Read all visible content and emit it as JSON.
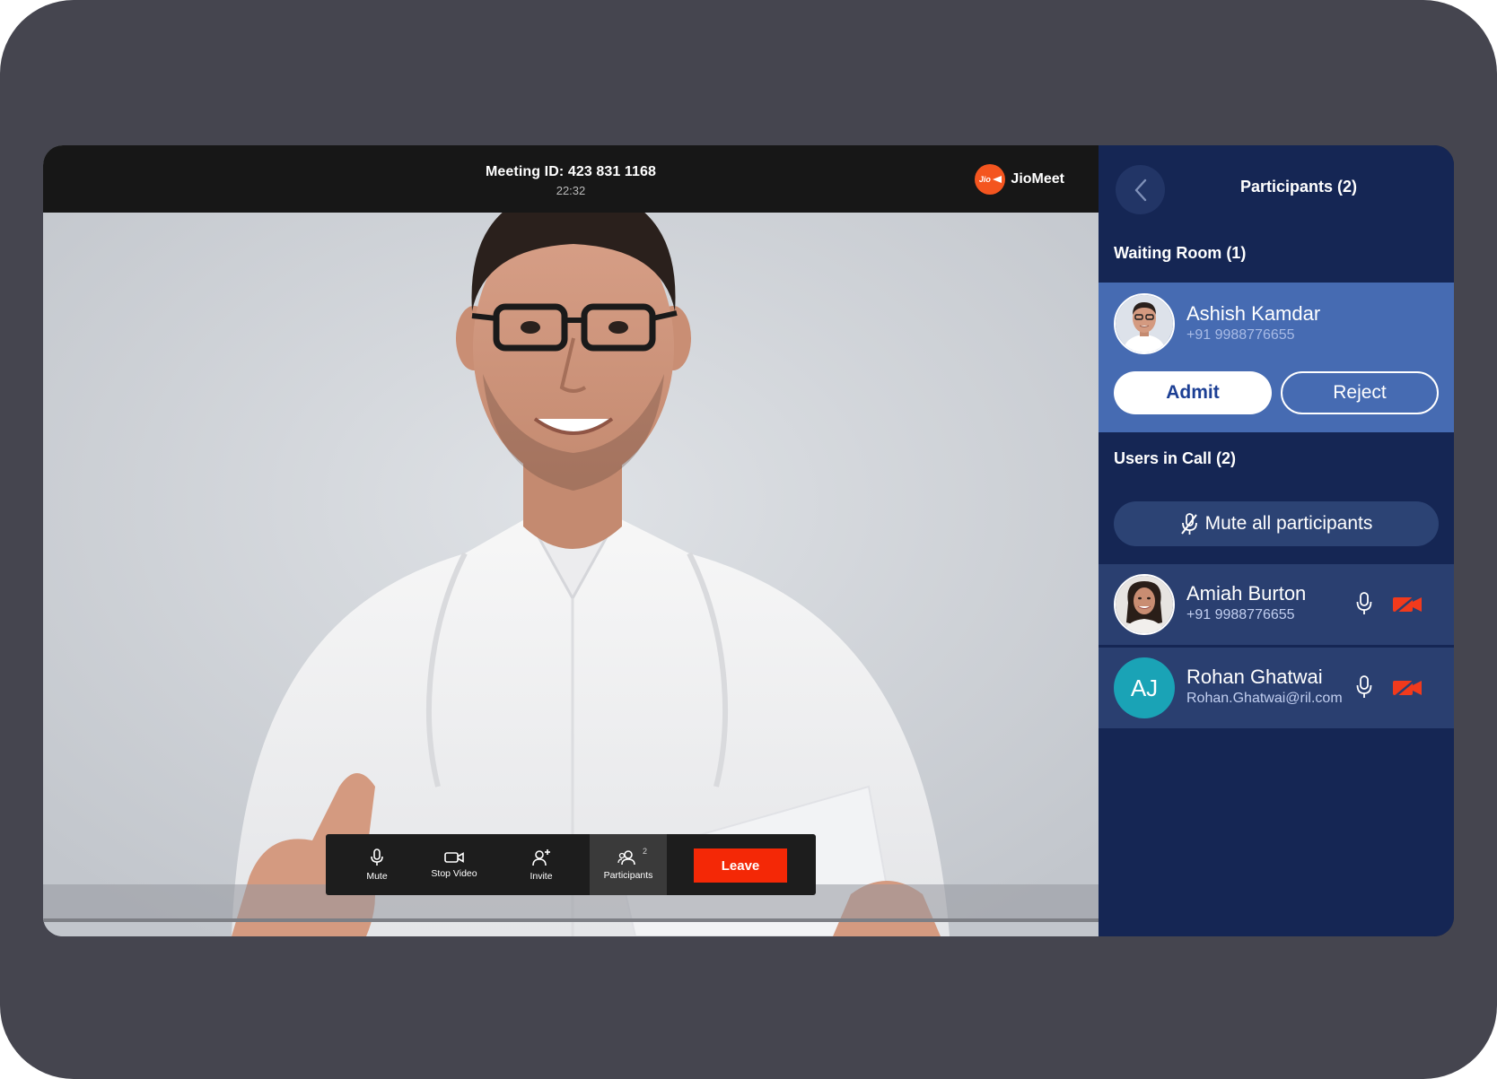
{
  "meeting": {
    "id_label": "Meeting ID: 423 831 1168",
    "time": "22:32",
    "brand_logo_text": "Jio",
    "brand_name": "JioMeet"
  },
  "toolbar": {
    "mute_label": "Mute",
    "stop_video_label": "Stop Video",
    "invite_label": "Invite",
    "participants_label": "Participants",
    "participants_count": "2",
    "leave_label": "Leave"
  },
  "panel": {
    "title": "Participants (2)",
    "waiting_room_title": "Waiting Room (1)",
    "waiting": {
      "name": "Ashish Kamdar",
      "phone": "+91 9988776655",
      "admit_label": "Admit",
      "reject_label": "Reject"
    },
    "users_in_call_title": "Users in Call (2)",
    "mute_all_label": "Mute all participants",
    "users": [
      {
        "name": "Amiah Burton",
        "detail": "+91 9988776655",
        "initials": ""
      },
      {
        "name": "Rohan Ghatwai",
        "detail": "Rohan.Ghatwai@ril.com",
        "initials": "AJ"
      }
    ]
  },
  "colors": {
    "device_frame": "#45454f",
    "panel_bg": "#152654",
    "waiting_card": "#466bb2",
    "user_row": "#2a3f70",
    "leave_red": "#f42806",
    "video_off_red": "#f13a1c",
    "brand_orange": "#f4551f",
    "initials_avatar": "#1aa3b6"
  },
  "icons": {
    "back": "chevron-left-icon",
    "mic": "microphone-icon",
    "video": "video-camera-icon",
    "invite": "add-user-icon",
    "participants": "participants-icon",
    "mute_all": "microphone-off-icon",
    "video_off": "video-off-icon"
  }
}
